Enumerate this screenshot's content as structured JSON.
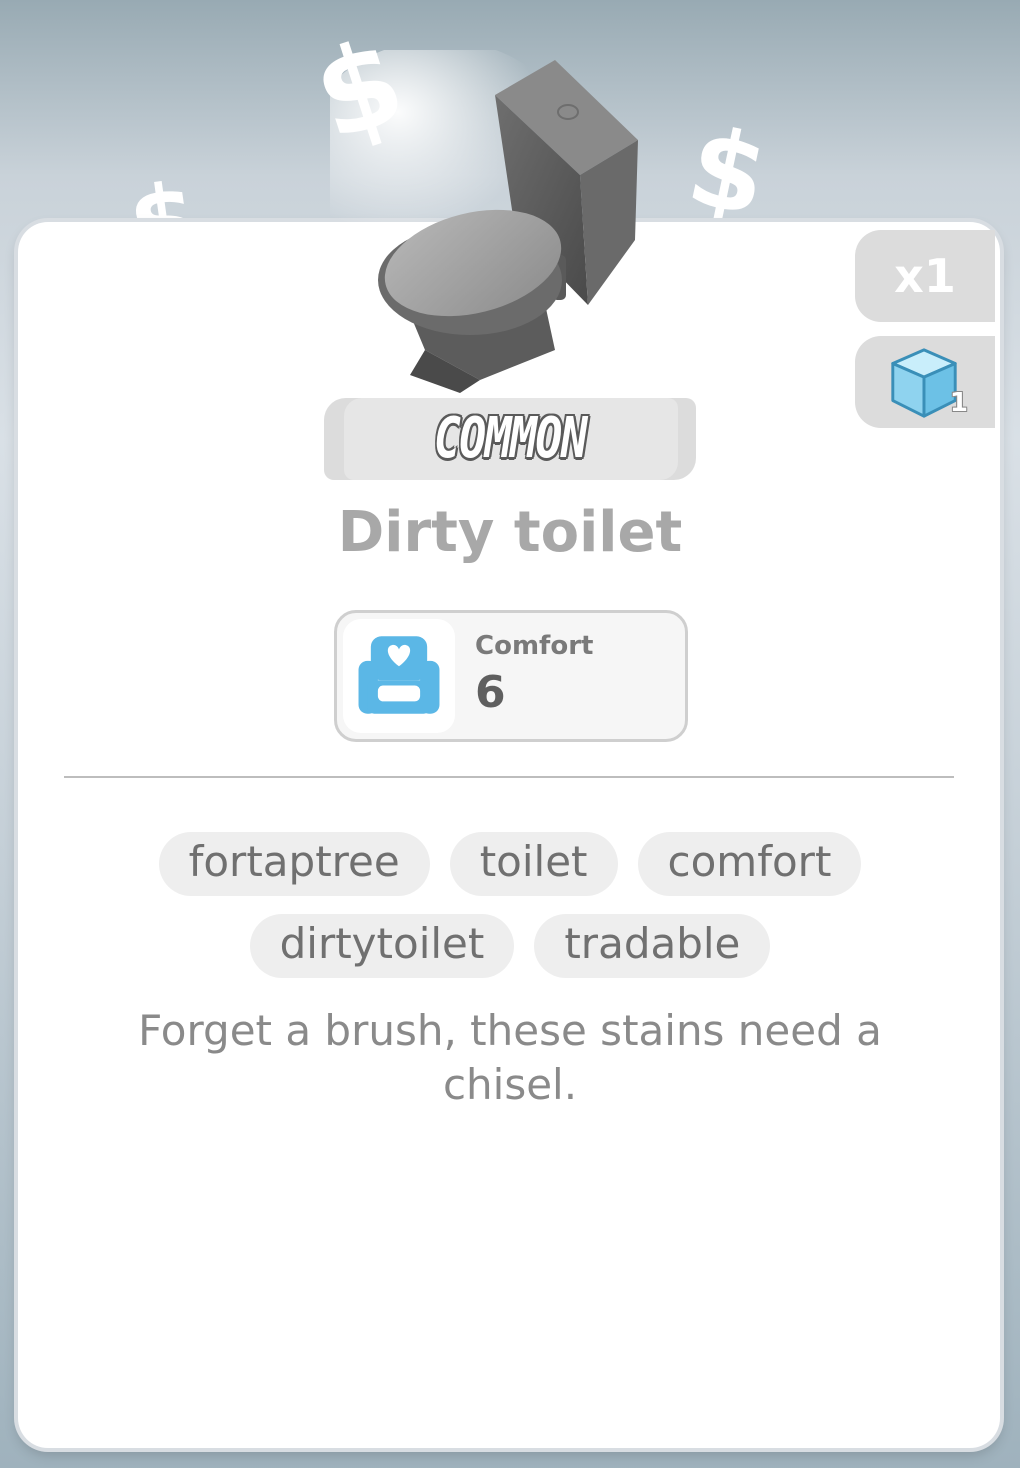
{
  "background_decor": {
    "symbol": "$"
  },
  "item": {
    "rarity": "COMMON",
    "name": "Dirty toilet",
    "quantity": "x1",
    "cube_count": "1",
    "stat": {
      "label": "Comfort",
      "value": "6",
      "icon": "armchair-heart-icon"
    },
    "tags": [
      "fortaptree",
      "toilet",
      "comfort",
      "dirtytoilet",
      "tradable"
    ],
    "description": "Forget a brush, these stains need a chisel."
  },
  "colors": {
    "card_bg": "#ffffff",
    "rarity_gray": "#dcdcdc",
    "stat_icon_blue": "#5bb7e6",
    "cube_blue": "#9fdcf3"
  }
}
